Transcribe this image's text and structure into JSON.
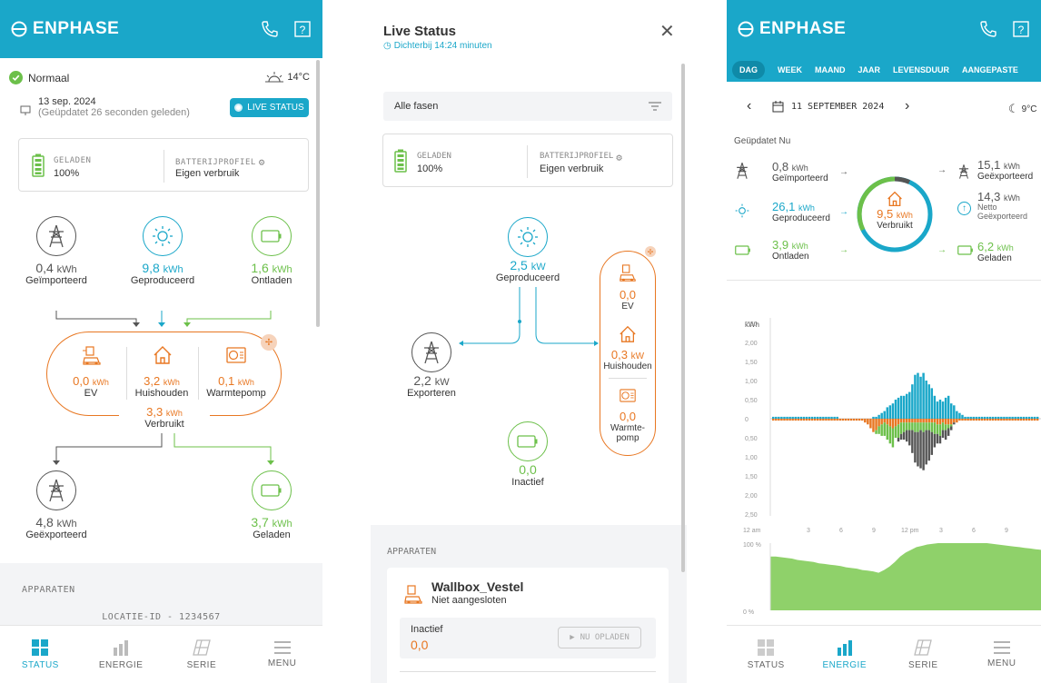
{
  "colors": {
    "brand": "#1aa7c9",
    "orange": "#e87722",
    "green": "#6cc04a",
    "gray": "#555555"
  },
  "p1": {
    "logo": "ENPHASE",
    "status": "Normaal",
    "weather": "14°C",
    "date": "13 sep. 2024",
    "updated": "(Geüpdatet 26 seconden geleden)",
    "live_btn": "LIVE STATUS",
    "battery": {
      "label": "GELADEN",
      "value": "100%",
      "profile_label": "BATTERIJPROFIEL",
      "profile_value": "Eigen verbruik"
    },
    "imported": {
      "value": "0,4",
      "unit": "kWh",
      "label": "Geïmporteerd"
    },
    "produced": {
      "value": "9,8",
      "unit": "kWh",
      "label": "Geproduceerd"
    },
    "discharged": {
      "value": "1,6",
      "unit": "kWh",
      "label": "Ontladen"
    },
    "ev": {
      "value": "0,0",
      "unit": "kWh",
      "label": "EV"
    },
    "house": {
      "value": "3,2",
      "unit": "kWh",
      "label": "Huishouden"
    },
    "heatpump": {
      "value": "0,1",
      "unit": "kWh",
      "label": "Warmtepomp"
    },
    "consumed": {
      "value": "3,3",
      "unit": "kWh",
      "label": "Verbruikt"
    },
    "exported": {
      "value": "4,8",
      "unit": "kWh",
      "label": "Geëxporteerd"
    },
    "charged": {
      "value": "3,7",
      "unit": "kWh",
      "label": "Geladen"
    },
    "devices_header": "APPARATEN",
    "location": "LOCATIE-ID - 1234567",
    "nav": [
      "STATUS",
      "ENERGIE",
      "SERIE",
      "MENU"
    ]
  },
  "p2": {
    "title": "Live Status",
    "subtitle": "Dichterbij 14:24 minuten",
    "phases": "Alle fasen",
    "battery": {
      "label": "GELADEN",
      "value": "100%",
      "profile_label": "BATTERIJPROFIEL",
      "profile_value": "Eigen verbruik"
    },
    "produced": {
      "value": "2,5",
      "unit": "kW",
      "label": "Geproduceerd"
    },
    "export": {
      "value": "2,2",
      "unit": "kW",
      "label": "Exporteren"
    },
    "ev": {
      "value": "0,0",
      "label": "EV"
    },
    "house": {
      "value": "0,3",
      "unit": "kW",
      "label": "Huishouden"
    },
    "heatpump": {
      "value": "0,0",
      "label1": "Warmte-",
      "label2": "pomp"
    },
    "battery_node": {
      "value": "0,0",
      "label": "Inactief"
    },
    "devices_header": "APPARATEN",
    "device_name": "Wallbox_Vestel",
    "device_status": "Niet aangesloten",
    "inactive_label": "Inactief",
    "inactive_value": "0,0",
    "charge_btn": "NU OPLADEN"
  },
  "p3": {
    "logo": "ENPHASE",
    "tabs": [
      "DAG",
      "WEEK",
      "MAAND",
      "JAAR",
      "LEVENSDUUR",
      "AANGEPASTE"
    ],
    "date": "11 SEPTEMBER 2024",
    "weather": "9°C",
    "updated": "Geüpdatet Nu",
    "imported": {
      "value": "0,8",
      "unit": "kWh",
      "label": "Geïmporteerd"
    },
    "produced": {
      "value": "26,1",
      "unit": "kWh",
      "label": "Geproduceerd"
    },
    "discharged": {
      "value": "3,9",
      "unit": "kWh",
      "label": "Ontladen"
    },
    "consumed": {
      "value": "9,5",
      "unit": "kWh",
      "label": "Verbruikt"
    },
    "exported": {
      "value": "15,1",
      "unit": "kWh",
      "label": "Geëxporteerd"
    },
    "net": {
      "value": "14,3",
      "unit": "kWh",
      "label1": "Netto",
      "label2": "Geëxporteerd"
    },
    "charged": {
      "value": "6,2",
      "unit": "kWh",
      "label": "Geladen"
    },
    "nav": [
      "STATUS",
      "ENERGIE",
      "SERIE",
      "MENU"
    ]
  },
  "chart_data": [
    {
      "type": "bar",
      "ylabel": "kWh",
      "yticks": [
        "2,50",
        "2,00",
        "1,50",
        "1,00",
        "0,50",
        "0",
        "0,50",
        "1,00",
        "1,50",
        "2,00",
        "2,50"
      ],
      "xticks": [
        "12 am",
        "3",
        "6",
        "9",
        "12 pm",
        "3",
        "6",
        "9"
      ],
      "series": [
        {
          "name": "Geproduceerd",
          "color": "#1aa7c9",
          "values": [
            0.05,
            0.05,
            0.05,
            0.05,
            0.05,
            0.05,
            0.05,
            0.05,
            0.05,
            0.05,
            0.05,
            0.05,
            0.05,
            0.05,
            0.05,
            0.05,
            0.05,
            0.05,
            0.05,
            0.05,
            0.05,
            0.05,
            0.05,
            0.05,
            0,
            0,
            0,
            0,
            0,
            0,
            0,
            0,
            0,
            0,
            0,
            0,
            0.05,
            0.05,
            0.1,
            0.15,
            0.2,
            0.3,
            0.35,
            0.4,
            0.5,
            0.55,
            0.6,
            0.6,
            0.65,
            0.7,
            0.9,
            1.15,
            1.2,
            1.1,
            1.2,
            1.0,
            0.9,
            0.8,
            0.6,
            0.45,
            0.5,
            0.45,
            0.55,
            0.6,
            0.4,
            0.35,
            0.2,
            0.15,
            0.1,
            0.05,
            0.05,
            0.05,
            0.05,
            0.05,
            0.05,
            0.05,
            0.05,
            0.05,
            0.05,
            0.05,
            0.05,
            0.05,
            0.05,
            0.05,
            0.05,
            0.05,
            0.05,
            0.05,
            0.05,
            0.05,
            0.05,
            0.05,
            0.05,
            0.05,
            0.05,
            0.05
          ]
        },
        {
          "name": "Verbruikt",
          "color": "#e87722",
          "values": [
            0.05,
            0.05,
            0.05,
            0.05,
            0.05,
            0.05,
            0.05,
            0.05,
            0.05,
            0.05,
            0.05,
            0.05,
            0.05,
            0.05,
            0.05,
            0.05,
            0.05,
            0.05,
            0.05,
            0.05,
            0.05,
            0.05,
            0.05,
            0.05,
            0.05,
            0.05,
            0.05,
            0.05,
            0.05,
            0.05,
            0.05,
            0.05,
            0.05,
            0.1,
            0.15,
            0.25,
            0.35,
            0.3,
            0.2,
            0.15,
            0.1,
            0.15,
            0.2,
            0.25,
            0.2,
            0.15,
            0.1,
            0.1,
            0.1,
            0.1,
            0.1,
            0.1,
            0.1,
            0.1,
            0.1,
            0.1,
            0.1,
            0.1,
            0.1,
            0.15,
            0.15,
            0.1,
            0.15,
            0.15,
            0.15,
            0.1,
            0.1,
            0.05,
            0.05,
            0.05,
            0.05,
            0.05,
            0.05,
            0.05,
            0.05,
            0.05,
            0.05,
            0.05,
            0.05,
            0.05,
            0.05,
            0.05,
            0.05,
            0.05,
            0.05,
            0.05,
            0.05,
            0.05,
            0.05,
            0.05,
            0.05,
            0.05,
            0.05,
            0.05,
            0.05,
            0.05
          ]
        },
        {
          "name": "Geladen",
          "color": "#6cc04a",
          "values": [
            0,
            0,
            0,
            0,
            0,
            0,
            0,
            0,
            0,
            0,
            0,
            0,
            0,
            0,
            0,
            0,
            0,
            0,
            0,
            0,
            0,
            0,
            0,
            0,
            0,
            0,
            0,
            0,
            0,
            0,
            0,
            0,
            0,
            0,
            0,
            0,
            0,
            0.1,
            0.2,
            0.3,
            0.35,
            0.4,
            0.45,
            0.5,
            0.3,
            0.35,
            0.3,
            0.25,
            0.2,
            0.2,
            0.2,
            0.25,
            0.25,
            0.2,
            0.25,
            0.2,
            0.2,
            0.25,
            0.3,
            0.25,
            0.3,
            0.2,
            0.15,
            0.1,
            0.05,
            0,
            0,
            0,
            0,
            0,
            0,
            0,
            0,
            0,
            0,
            0,
            0,
            0,
            0,
            0,
            0,
            0,
            0,
            0,
            0,
            0,
            0,
            0,
            0,
            0,
            0,
            0,
            0,
            0,
            0,
            0
          ]
        },
        {
          "name": "Geëxporteerd",
          "color": "#555555",
          "values": [
            0,
            0,
            0,
            0,
            0,
            0,
            0,
            0,
            0,
            0,
            0,
            0,
            0,
            0,
            0,
            0,
            0,
            0,
            0,
            0,
            0,
            0,
            0,
            0,
            0,
            0,
            0,
            0,
            0,
            0,
            0,
            0,
            0,
            0,
            0,
            0,
            0,
            0,
            0,
            0,
            0,
            0,
            0,
            0,
            0,
            0.1,
            0.15,
            0.2,
            0.3,
            0.4,
            0.6,
            0.8,
            0.9,
            1.0,
            1.0,
            0.9,
            0.8,
            0.6,
            0.35,
            0.25,
            0.2,
            0.2,
            0.25,
            0.2,
            0.1,
            0.05,
            0,
            0,
            0,
            0,
            0,
            0,
            0,
            0,
            0,
            0,
            0,
            0,
            0,
            0,
            0,
            0,
            0,
            0,
            0,
            0,
            0,
            0,
            0,
            0,
            0,
            0,
            0,
            0,
            0,
            0
          ]
        }
      ]
    },
    {
      "type": "area",
      "yticks": [
        "100 %",
        "0 %"
      ],
      "series": [
        {
          "name": "Batterij",
          "color": "#8fd16a",
          "values": [
            80,
            80,
            79,
            78,
            77,
            75,
            74,
            73,
            72,
            70,
            69,
            68,
            67,
            66,
            64,
            63,
            62,
            60,
            59,
            58,
            56,
            60,
            65,
            72,
            80,
            86,
            90,
            94,
            96,
            98,
            99,
            100,
            100,
            100,
            100,
            100,
            100,
            100,
            100,
            100,
            100,
            99,
            98,
            97,
            96,
            95,
            94,
            93,
            92,
            91,
            90
          ]
        }
      ]
    }
  ]
}
